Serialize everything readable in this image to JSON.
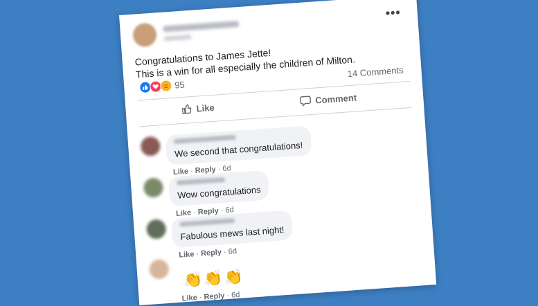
{
  "post": {
    "line1": "Congratulations to James Jette!",
    "line2": "This is a win for all especially the children of Milton.",
    "comments_count": "14 Comments",
    "reaction_count": "95",
    "reaction_icons": [
      "like-icon",
      "love-icon",
      "care-icon"
    ]
  },
  "actions": {
    "like_label": "Like",
    "comment_label": "Comment"
  },
  "comments": [
    {
      "text": "We second that congratulations!",
      "like": "Like",
      "reply": "Reply",
      "age": "6d"
    },
    {
      "text": "Wow congratulations",
      "like": "Like",
      "reply": "Reply",
      "age": "6d"
    },
    {
      "text": "Fabulous mews last night!",
      "like": "Like",
      "reply": "Reply",
      "age": "6d"
    },
    {
      "text": "",
      "like": "Like",
      "reply": "Reply",
      "age": "6d",
      "emoji": "👏👏👏"
    }
  ],
  "colors": {
    "background": "#3d7fc3",
    "card": "#ffffff",
    "bubble": "#f0f2f5",
    "meta_text": "#65676b"
  }
}
